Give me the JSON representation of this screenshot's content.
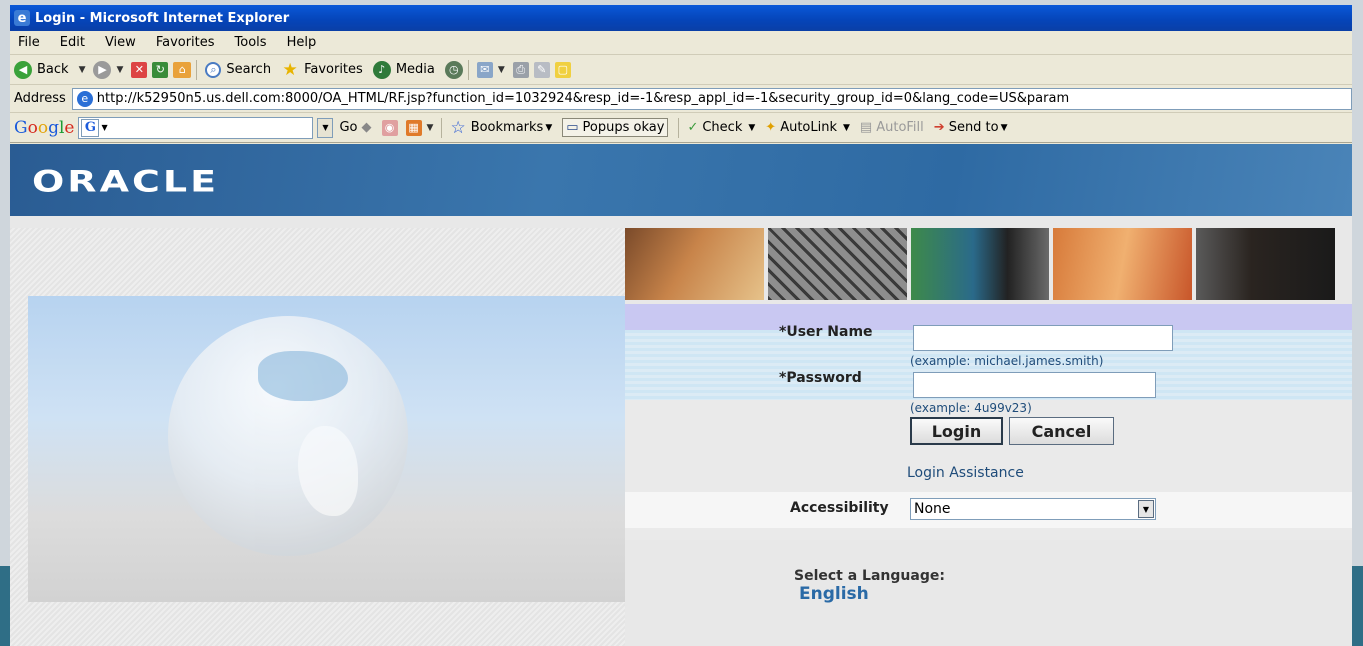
{
  "window": {
    "title": "Login - Microsoft Internet Explorer"
  },
  "menu": [
    "File",
    "Edit",
    "View",
    "Favorites",
    "Tools",
    "Help"
  ],
  "toolbar": {
    "back": "Back",
    "search": "Search",
    "favorites": "Favorites",
    "media": "Media"
  },
  "address": {
    "label": "Address",
    "url": "http://k52950n5.us.dell.com:8000/OA_HTML/RF.jsp?function_id=1032924&resp_id=-1&resp_appl_id=-1&security_group_id=0&lang_code=US&param"
  },
  "google_bar": {
    "logo": [
      "G",
      "o",
      "o",
      "g",
      "l",
      "e"
    ],
    "go": "Go",
    "bookmarks": "Bookmarks",
    "popups": "Popups okay",
    "check": "Check",
    "autolink": "AutoLink",
    "autofill": "AutoFill",
    "send_to": "Send to"
  },
  "banner": {
    "logo": "ORACLE"
  },
  "login": {
    "username_label": "*User Name",
    "username_value": "",
    "username_hint": "(example: michael.james.smith)",
    "password_label": "*Password",
    "password_value": "",
    "password_hint": "(example: 4u99v23)",
    "login_button": "Login",
    "cancel_button": "Cancel",
    "assistance_link": "Login Assistance",
    "accessibility_label": "Accessibility",
    "accessibility_value": "None",
    "language_title": "Select a Language:",
    "language_link": "English"
  }
}
